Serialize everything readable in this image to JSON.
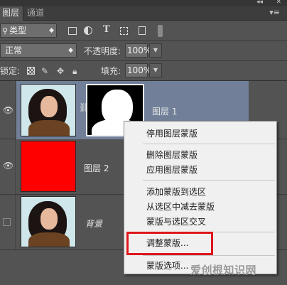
{
  "tabs": [
    {
      "label": "图层",
      "active": true
    },
    {
      "label": "通道",
      "active": false
    }
  ],
  "filter": {
    "label": "类型"
  },
  "blend": {
    "value": "正常"
  },
  "opacity": {
    "label": "不透明度:",
    "value": "100%"
  },
  "lock": {
    "label": "锁定:"
  },
  "fill": {
    "label": "填充:",
    "value": "100%"
  },
  "layers": [
    {
      "name": "图层 1",
      "visible": true,
      "selected": true,
      "has_mask": true
    },
    {
      "name": "图层 2",
      "visible": true,
      "selected": false,
      "color": "#ff0000"
    },
    {
      "name": "背景",
      "visible": false,
      "selected": false
    }
  ],
  "context_menu": {
    "items": [
      "停用图层蒙版",
      "删除图层蒙版",
      "应用图层蒙版",
      "添加蒙版到选区",
      "从选区中减去蒙版",
      "蒙版与选区交叉",
      "调整蒙版...",
      "蒙版选项..."
    ],
    "highlighted_item": "调整蒙版..."
  },
  "watermark": {
    "text": "爱创根知识网"
  },
  "colors": {
    "panel_bg": "#535353",
    "selected_layer": "#718098",
    "highlight_border": "#e0161b",
    "red_layer": "#ff0000"
  },
  "icons": {
    "collapse": "double-chevron-left-icon",
    "close": "close-icon",
    "panel_menu": "panel-menu-icon",
    "visibility": "eye-icon",
    "link": "chain-link-icon"
  }
}
